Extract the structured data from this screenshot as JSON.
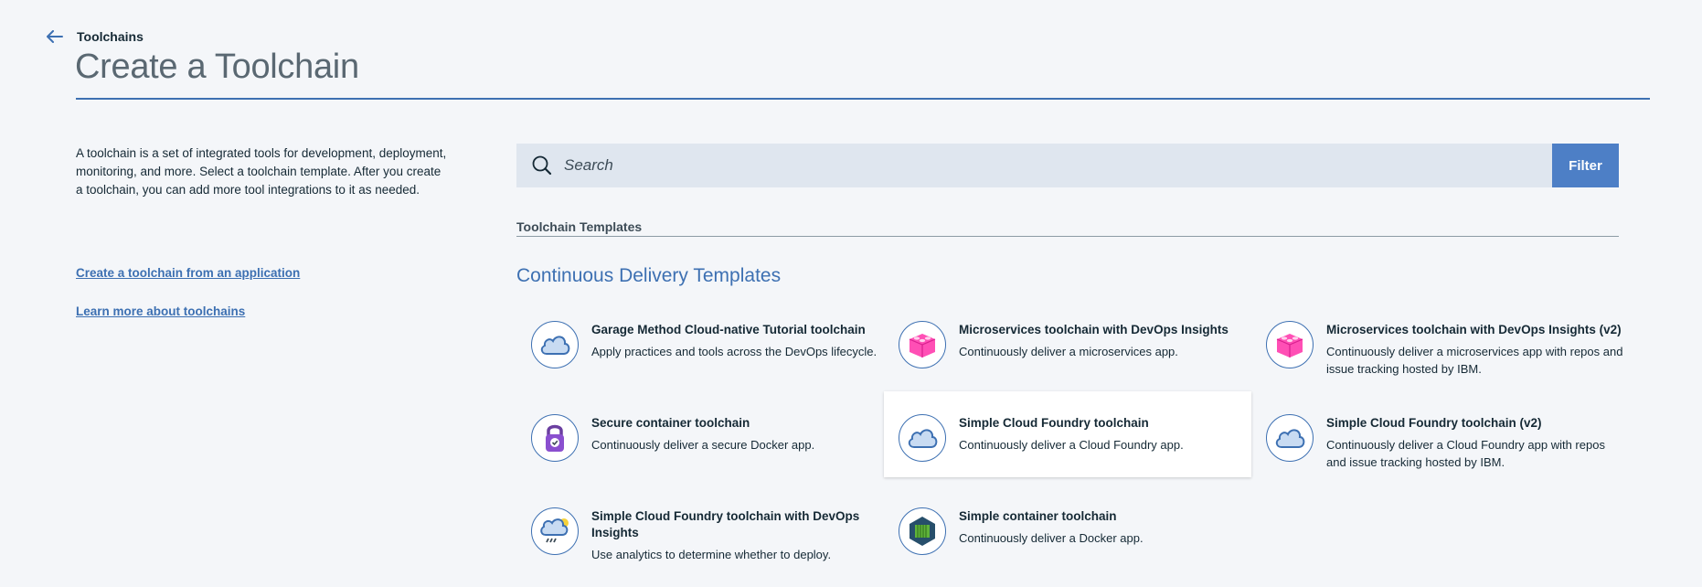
{
  "header": {
    "breadcrumb": "Toolchains",
    "title": "Create a Toolchain"
  },
  "sidebar": {
    "intro": "A toolchain is a set of integrated tools for development, deployment, monitoring, and more. Select a toolchain template. After you create a toolchain, you can add more tool integrations to it as needed.",
    "links": [
      "Create a toolchain from an application",
      "Learn more about toolchains"
    ]
  },
  "search": {
    "placeholder": "Search",
    "filter_label": "Filter"
  },
  "section_label": "Toolchain Templates",
  "group_heading": "Continuous Delivery Templates",
  "templates": [
    {
      "title": "Garage Method Cloud-native Tutorial toolchain",
      "desc": "Apply practices and tools across the DevOps lifecycle.",
      "icon": "cloud-icon"
    },
    {
      "title": "Microservices toolchain with DevOps Insights",
      "desc": "Continuously deliver a microservices app.",
      "icon": "pink-block-icon"
    },
    {
      "title": "Microservices toolchain with DevOps Insights (v2)",
      "desc": "Continuously deliver a microservices app with repos and issue tracking hosted by IBM.",
      "icon": "pink-block-icon"
    },
    {
      "title": "Secure container toolchain",
      "desc": "Continuously deliver a secure Docker app.",
      "icon": "lock-icon"
    },
    {
      "title": "Simple Cloud Foundry toolchain",
      "desc": "Continuously deliver a Cloud Foundry app.",
      "icon": "cloud-icon"
    },
    {
      "title": "Simple Cloud Foundry toolchain (v2)",
      "desc": "Continuously deliver a Cloud Foundry app with repos and issue tracking hosted by IBM.",
      "icon": "cloud-icon"
    },
    {
      "title": "Simple Cloud Foundry toolchain with DevOps Insights",
      "desc": "Use analytics to determine whether to deploy.",
      "icon": "weather-cloud-icon"
    },
    {
      "title": "Simple container toolchain",
      "desc": "Continuously deliver a Docker app.",
      "icon": "container-icon"
    }
  ],
  "colors": {
    "accent": "#3d70b2",
    "filter_button": "#4d7fc6",
    "background": "#f4f6f9",
    "pink": "#ff4fb5"
  }
}
